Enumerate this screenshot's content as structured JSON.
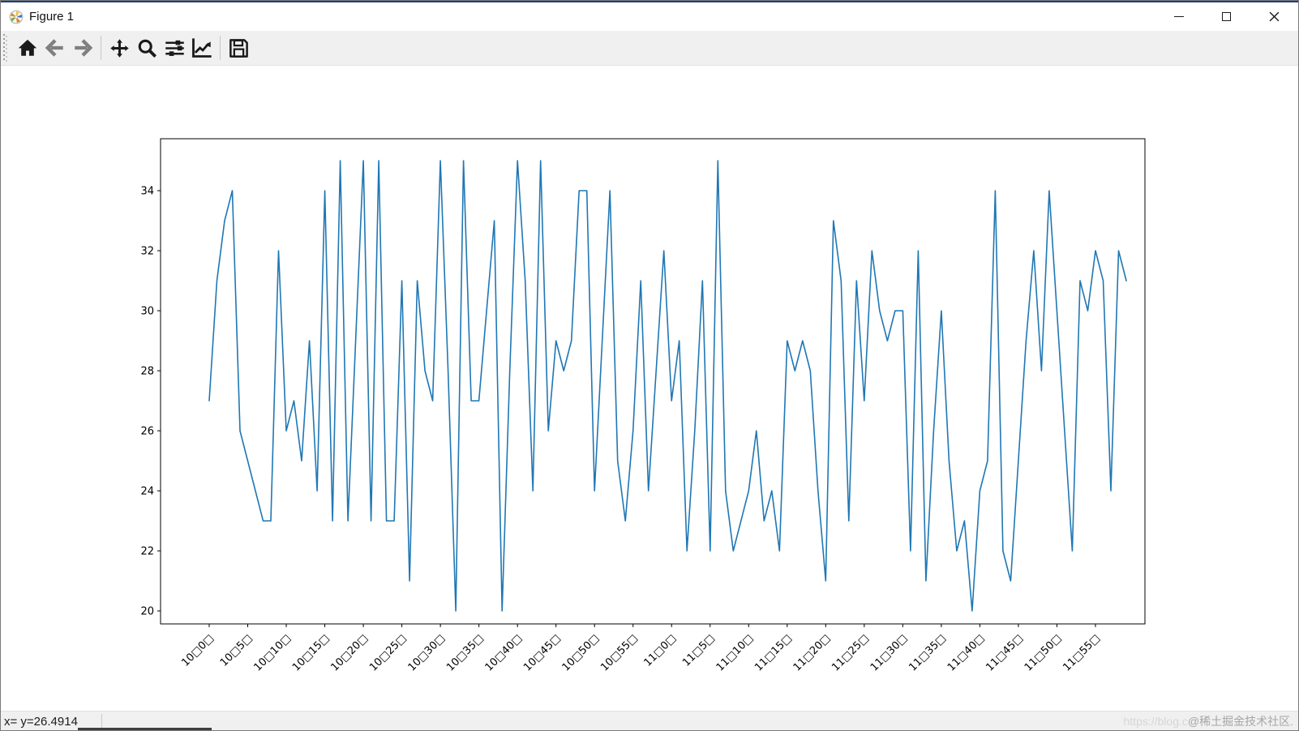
{
  "window": {
    "title": "Figure 1",
    "buttons": [
      "minimize",
      "maximize",
      "close"
    ]
  },
  "toolbar": {
    "icons": [
      "home",
      "back",
      "forward",
      "pan",
      "zoom",
      "configure-subplots",
      "customize-plot",
      "save"
    ]
  },
  "statusbar": {
    "text": "x= y=26.4914"
  },
  "watermark": {
    "url_fragment": "https://blog.c",
    "community": "@稀土掘金技术社区."
  },
  "chart_data": {
    "type": "line",
    "title": "",
    "xlabel": "",
    "ylabel": "",
    "grid": false,
    "legend": null,
    "line_color": "#1f77b4",
    "yticks": [
      20,
      22,
      24,
      26,
      28,
      30,
      32,
      34
    ],
    "ylim": [
      19.55,
      35.75
    ],
    "x_start_time": "10:00",
    "x_interval_minutes": 1,
    "x_tick_every": 5,
    "x_tick_labels": [
      "10□0□",
      "10□5□",
      "10□10□",
      "10□15□",
      "10□20□",
      "10□25□",
      "10□30□",
      "10□35□",
      "10□40□",
      "10□45□",
      "10□50□",
      "10□55□",
      "11□0□",
      "11□5□",
      "11□10□",
      "11□15□",
      "11□20□",
      "11□25□",
      "11□30□",
      "11□35□",
      "11□40□",
      "11□45□",
      "11□50□",
      "11□55□"
    ],
    "values": [
      27,
      31,
      33,
      34,
      26,
      25,
      24,
      23,
      23,
      32,
      26,
      27,
      25,
      29,
      24,
      34,
      23,
      35,
      23,
      29,
      35,
      23,
      35,
      23,
      23,
      31,
      21,
      31,
      28,
      27,
      35,
      28,
      20,
      35,
      27,
      27,
      30,
      33,
      20,
      28,
      35,
      31,
      24,
      35,
      26,
      29,
      28,
      29,
      34,
      34,
      24,
      29,
      34,
      25,
      23,
      26,
      31,
      24,
      28,
      32,
      27,
      29,
      22,
      26,
      31,
      22,
      35,
      24,
      22,
      23,
      24,
      26,
      23,
      24,
      22,
      29,
      28,
      29,
      28,
      24,
      21,
      33,
      31,
      23,
      31,
      27,
      32,
      30,
      29,
      30,
      30,
      22,
      32,
      21,
      26,
      30,
      25,
      22,
      23,
      20,
      24,
      25,
      34,
      22,
      21,
      25,
      29,
      32,
      28,
      34,
      30,
      26,
      22,
      31,
      30,
      32,
      31,
      24,
      32,
      31
    ]
  }
}
